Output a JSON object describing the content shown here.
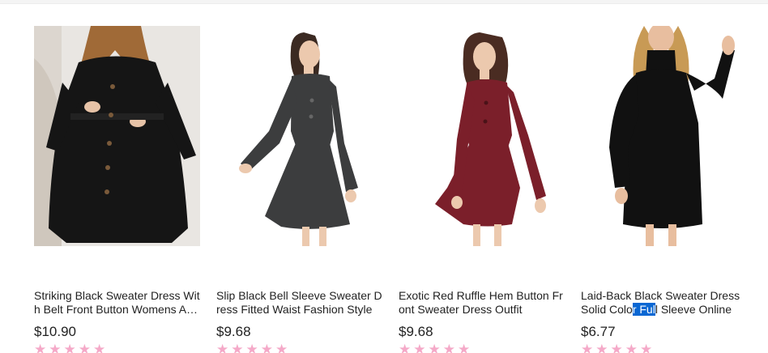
{
  "products": [
    {
      "title": "Striking Black Sweater Dress With Belt Front Button Womens A…",
      "price": "$10.90",
      "rating_stars": 5,
      "image_icon": "dress-photo-black-cardigan"
    },
    {
      "title": "Slip Black Bell Sleeve Sweater Dress Fitted Waist Fashion Style",
      "price": "$9.68",
      "rating_stars": 5,
      "image_icon": "dress-photo-grey-bell-sleeve"
    },
    {
      "title": "Exotic Red Ruffle Hem Button Front Sweater Dress Outfit",
      "price": "$9.68",
      "rating_stars": 5,
      "image_icon": "dress-photo-burgundy-ruffle"
    },
    {
      "title_before": "Laid-Back Black Sweater Dress Solid Colo",
      "title_selected": "r Ful",
      "title_after": "l Sleeve Online",
      "price": "$6.77",
      "rating_stars": 5,
      "image_icon": "dress-photo-black-turtleneck"
    }
  ],
  "colors": {
    "star": "#f5a9c8",
    "selection": "#0a67d3"
  },
  "star_glyph": "★★★★★"
}
